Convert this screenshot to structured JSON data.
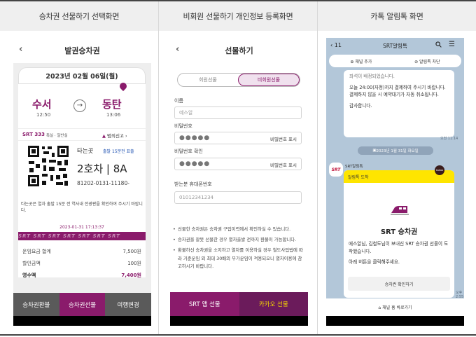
{
  "headers": [
    "승차권 선물하기 선택화면",
    "비회원 선물하기 개인정보 등록화면",
    "카톡 알림톡 화면"
  ],
  "ticket_screen": {
    "back_icon": "chevron-left-icon",
    "title": "발권승차권",
    "date": "2023년 02월 06일(월)",
    "from_station": "수서",
    "from_time": "12:50",
    "to_station": "동탄",
    "to_time": "13:06",
    "train_no": "SRT 333",
    "train_grade": "특실 · 일반실",
    "report_label": "범죄신고 ›",
    "boarding_label": "타는곳",
    "boarding_note": "출발 15분전 표출",
    "car": "2호차",
    "seat": "8A",
    "ticket_number": "81202-0131-11180-",
    "notice": "타는곳은 열차 출발 15분 전 역사내 전광판을 확인하여 주시기 바랍니다.",
    "issued_at": "2023-01-31 17:13:37",
    "strip_text": "SRT SRT SRT SRT SRT SRT SRT",
    "fare_rows": [
      {
        "label": "운임요금 합계",
        "value": "7,500원"
      },
      {
        "label": "할인금액",
        "value": "100원"
      },
      {
        "label": "영수액",
        "value": "7,400원"
      }
    ],
    "tabs": [
      "승차권환불",
      "승차권선물",
      "여행변경"
    ]
  },
  "gift_screen": {
    "back_icon": "chevron-left-icon",
    "title": "선물하기",
    "segments": [
      "회원선물",
      "비회원선물"
    ],
    "name_label": "이름",
    "name_placeholder": "예스알",
    "password_label": "비밀번호",
    "password_confirm_label": "비밀번호 확인",
    "password_dots": "●●●●●",
    "password_show": "비밀번호 표시",
    "recipient_label": "받는분 휴대폰번호",
    "recipient_placeholder": "01012341234",
    "bullets": [
      "선물한 승차권은 승차권 구입이력에서 확인하실 수 있습니다.",
      "승차권을 잘못 선물한 경우 열차출발 전까지 환불이 가능합니다.",
      "환불하신 승차권을 소지하고 열차를 이용하실 경우 철도사업법에 따라 기준운임 외 최대 30배의 부가운임이 적용되오니 열차이용에 참고하시기 바랍니다."
    ],
    "buttons": [
      "SRT 앱 선물",
      "카카오 선물"
    ]
  },
  "kakao_screen": {
    "back_label": "‹ 11",
    "title": "SRT알림톡",
    "chips": [
      "⊕ 채널 추가",
      "⊘ 알림톡 차단"
    ],
    "top_message": [
      "좌석이 배정되었습니다.",
      "",
      "오늘 24:00(자정)까지 결제하여 주시기 바랍니다.",
      "결제하지 않을 시 예약대기가 자동 취소됩니다.",
      "",
      "감사합니다."
    ],
    "top_time": "오전 11:14",
    "date_divider": "2023년 1월 31일 화요일",
    "avatar_text": "SRT",
    "sender": "SRT알림톡",
    "card_header": "알림톡 도착",
    "kakao_badge": "kakao",
    "card_title": "SRT 승차권",
    "card_body": [
      "에스알님, 김철도님이 보내신 SRT 승차권 선물이 도착했습니다.",
      "",
      "아래 버튼을 클릭해주세요."
    ],
    "card_button": "승차권 확인하기",
    "card_time": "오후 2:55",
    "footer": "⌂ 채널 홈 바로가기",
    "colors": {
      "brand": "#8a1b6b",
      "kakao_yellow": "#fee500",
      "chat_bg": "#b3c7d9"
    }
  }
}
